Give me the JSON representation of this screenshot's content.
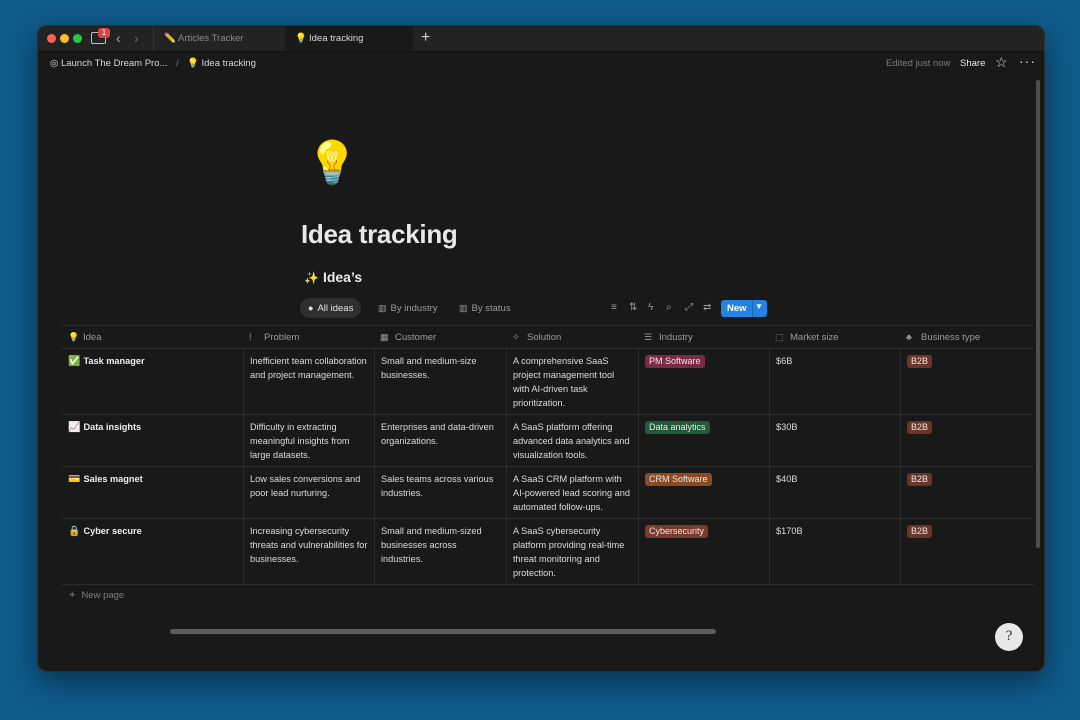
{
  "browser": {
    "notification_count": "1",
    "tabs": [
      {
        "icon": "✏️",
        "label": "Articles Tracker"
      },
      {
        "icon": "💡",
        "label": "Idea tracking"
      }
    ]
  },
  "topbar": {
    "breadcrumb": [
      {
        "icon": "◎",
        "label": "Launch The Dream Pro..."
      },
      {
        "icon": "💡",
        "label": "Idea tracking"
      }
    ],
    "separator": "/",
    "edited": "Edited just now",
    "share": "Share"
  },
  "page": {
    "icon": "💡",
    "title": "Idea tracking",
    "db_icon": "✨",
    "db_title": "Idea’s"
  },
  "views": [
    {
      "label": "All ideas",
      "active": true
    },
    {
      "label": "By industry",
      "active": false
    },
    {
      "label": "By status",
      "active": false
    }
  ],
  "new_button": "New",
  "columns": [
    {
      "icon": "💡",
      "label": "Idea"
    },
    {
      "icon": "!",
      "label": "Problem"
    },
    {
      "icon": "▦",
      "label": "Customer"
    },
    {
      "icon": "✧",
      "label": "Solution"
    },
    {
      "icon": "☰",
      "label": "Industry"
    },
    {
      "icon": "⬚",
      "label": "Market size"
    },
    {
      "icon": "♣",
      "label": "Business type"
    }
  ],
  "rows": [
    {
      "emoji": "✅",
      "name": "Task manager",
      "problem": "Inefficient team collaboration and project management.",
      "customer": "Small and medium-size businesses.",
      "solution": "A comprehensive SaaS project management tool with AI-driven task prioritization.",
      "industry": "PM Software",
      "industry_color": "#7a2b45",
      "market_size": "$6B",
      "business_type": "B2B"
    },
    {
      "emoji": "📈",
      "name": "Data insights",
      "problem": "Difficulty in extracting meaningful insights from large datasets.",
      "customer": "Enterprises and data-driven organizations.",
      "solution": "A SaaS platform offering advanced data analytics and visualization tools.",
      "industry": "Data analytics",
      "industry_color": "#1f5a3a",
      "market_size": "$30B",
      "business_type": "B2B"
    },
    {
      "emoji": "💳",
      "name": "Sales magnet",
      "problem": "Low sales conversions and poor lead nurturing.",
      "customer": "Sales teams across various industries.",
      "solution": "A SaaS CRM platform with AI-powered lead scoring and automated follow-ups.",
      "industry": "CRM Software",
      "industry_color": "#8a4a22",
      "market_size": "$40B",
      "business_type": "B2B"
    },
    {
      "emoji": "🔒",
      "name": "Cyber secure",
      "problem": "Increasing cybersecurity threats and vulnerabilities for businesses.",
      "customer": "Small and medium-sized businesses across industries.",
      "solution": "A SaaS cybersecurity platform providing real-time threat monitoring and protection.",
      "industry": "Cybersecurity",
      "industry_color": "#7b3a2a",
      "market_size": "$170B",
      "business_type": "B2B"
    }
  ],
  "business_type_color": "#6b3528",
  "new_page": "New page",
  "help_glyph": "?"
}
